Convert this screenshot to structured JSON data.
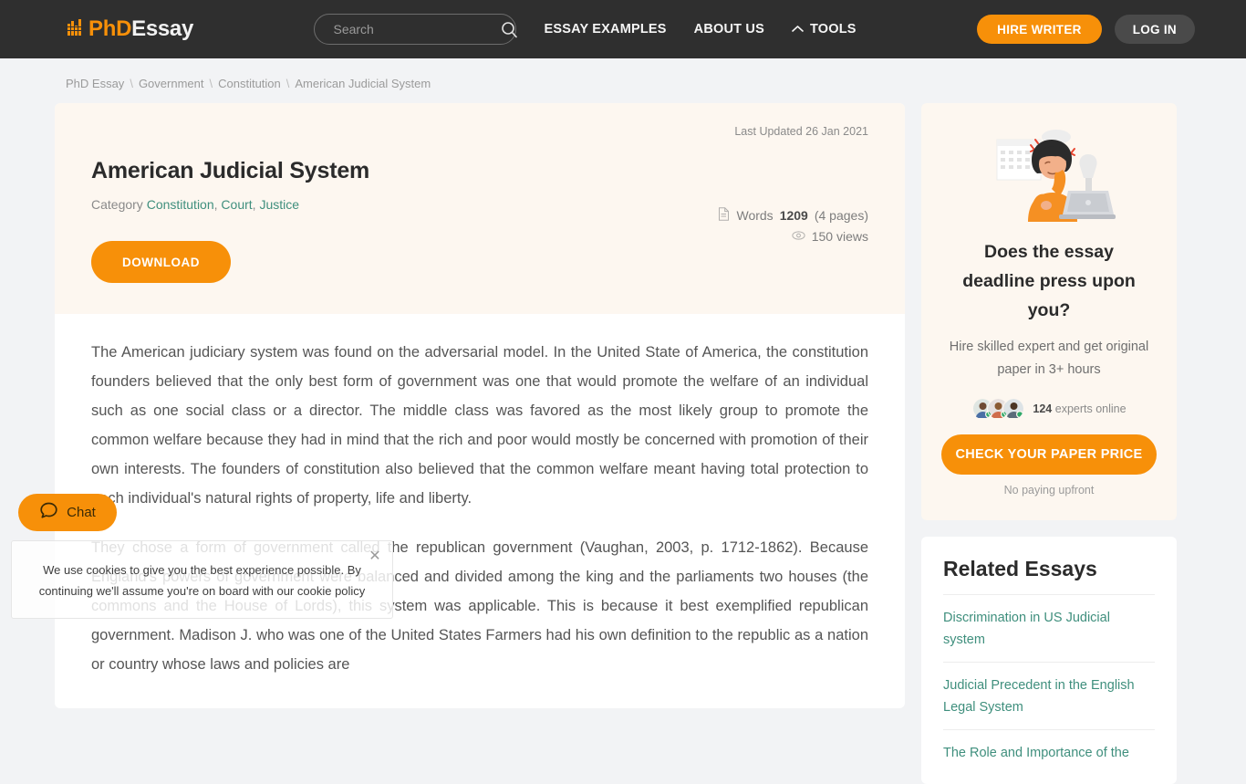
{
  "header": {
    "logo": {
      "prefix": "PhD",
      "suffix": "Essay",
      "icon": "books-icon"
    },
    "search": {
      "placeholder": "Search",
      "value": "",
      "icon": "search-icon"
    },
    "nav": [
      {
        "label": "ESSAY EXAMPLES",
        "icon": null
      },
      {
        "label": "ABOUT US",
        "icon": null
      },
      {
        "label": "TOOLS",
        "icon": "chevron-up-icon"
      }
    ],
    "hire_writer_label": "HIRE WRITER",
    "log_in_label": "LOG IN",
    "accent_color": "#f79009",
    "background_color": "#2f2f2f"
  },
  "breadcrumb": {
    "separator": "\\",
    "items": [
      {
        "label": "PhD Essay",
        "current": false
      },
      {
        "label": "Government",
        "current": false
      },
      {
        "label": "Constitution",
        "current": false
      },
      {
        "label": "American Judicial System",
        "current": true
      }
    ]
  },
  "article": {
    "last_updated": "Last Updated 26 Jan 2021",
    "title": "American Judicial System",
    "category_label": "Category",
    "categories": [
      "Constitution",
      "Court",
      "Justice"
    ],
    "download_label": "DOWNLOAD",
    "meta": {
      "words_label": "Words",
      "words_count": "1209",
      "pages": "(4 pages)",
      "views": "150 views",
      "words_icon": "document-icon",
      "views_icon": "eye-icon"
    },
    "paragraphs": [
      "The American judiciary system was found on the adversarial model. In the United State of America, the constitution founders believed that the only best form of government was one that would promote the welfare of an individual such as one social class or a director. The middle class was favored as the most likely group to promote the common welfare because they had in mind that the rich and poor would mostly be concerned with promotion of their own interests. The founders of constitution also believed that the common welfare meant having total protection to each individual's natural rights of property, life and liberty.",
      "They chose a form of government called the republican government (Vaughan, 2003, p. 1712-1862). Because England's powers of government were balanced and divided among the king and the parliaments two houses (the commons and the House of Lords), this system was applicable. This is because it best exemplified republican government. Madison J. who was one of the United States Farmers had his own definition to the republic as a nation or country whose laws and policies are"
    ]
  },
  "sidebar": {
    "promo": {
      "illustration": "stressed-student-illustration",
      "title_line1": "Does the essay",
      "title_line2": "deadline press upon you?",
      "subtitle": "Hire skilled expert and get original paper in 3+ hours",
      "experts_count": "124",
      "experts_label": "experts online",
      "cta_label": "CHECK YOUR PAPER PRICE",
      "footnote": "No paying upfront"
    },
    "related": {
      "title": "Related Essays",
      "items": [
        "Discrimination in US Judicial system",
        "Judicial Precedent in the English Legal System",
        "The Role and Importance of the"
      ]
    }
  },
  "chat_widget": {
    "label": "Chat",
    "icon": "chat-bubble-icon"
  },
  "cookie_banner": {
    "text_before_link": "We use cookies to give you the best experience possible. By continuing we'll assume you're on board with our cookie ",
    "link_label": "policy",
    "close_icon": "close-icon"
  }
}
